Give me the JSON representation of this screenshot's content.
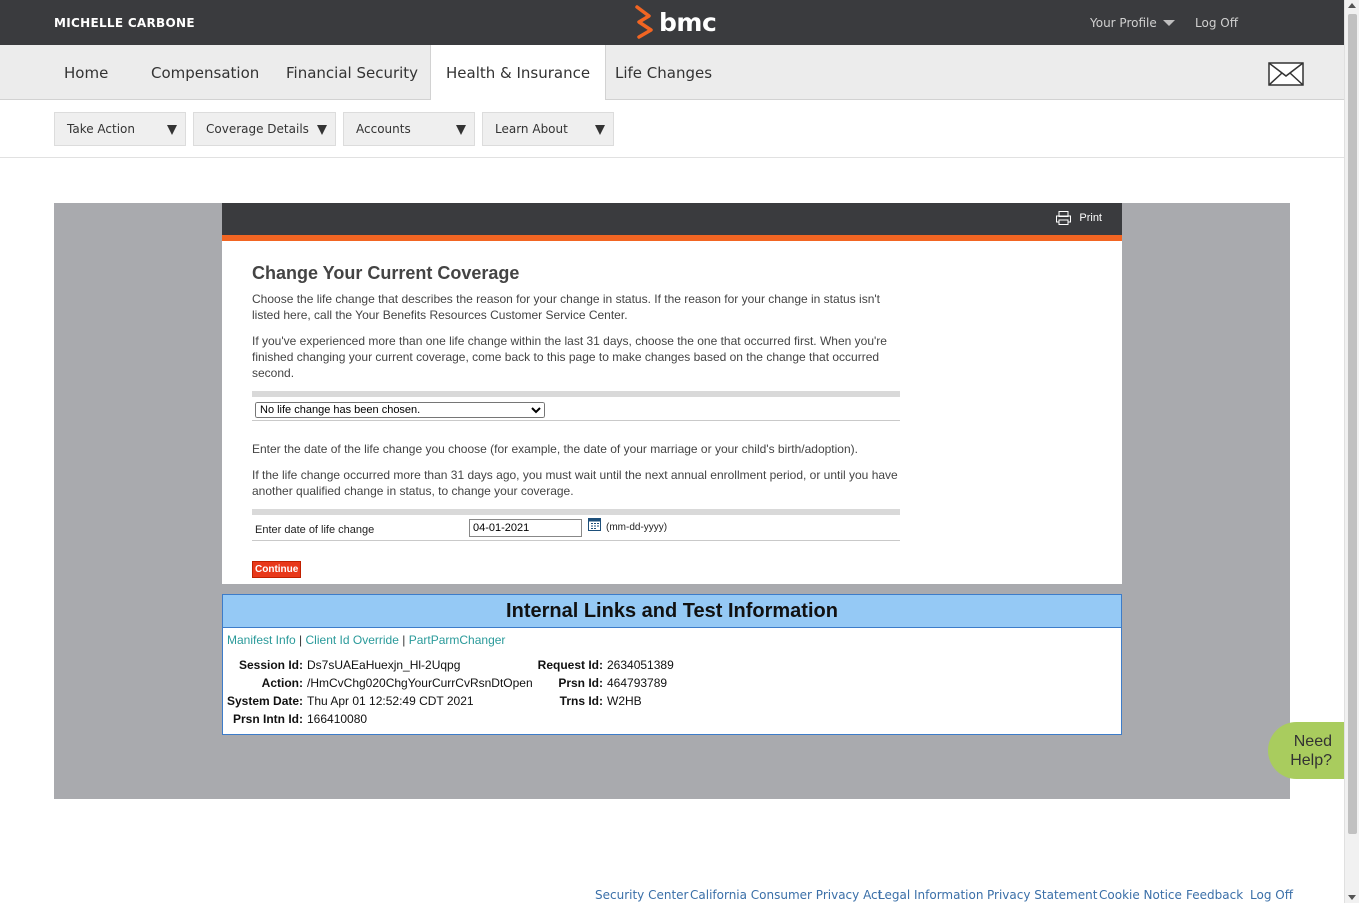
{
  "header": {
    "user_name": "MICHELLE CARBONE",
    "logo_text": "bmc",
    "profile_label": "Your Profile",
    "logoff_label": "Log Off"
  },
  "main_nav": {
    "tabs": [
      {
        "label": "Home"
      },
      {
        "label": "Compensation"
      },
      {
        "label": "Financial Security"
      },
      {
        "label": "Health & Insurance",
        "active": true
      },
      {
        "label": "Life Changes"
      }
    ]
  },
  "sub_nav": {
    "dropdowns": [
      {
        "label": "Take Action"
      },
      {
        "label": "Coverage Details"
      },
      {
        "label": "Accounts"
      },
      {
        "label": "Learn About"
      }
    ]
  },
  "panel": {
    "print_label": "Print",
    "title": "Change Your Current Coverage",
    "para1": "Choose the life change that describes the reason for your change in status. If the reason for your change in status isn't listed here, call the Your Benefits Resources Customer Service Center.",
    "para2": "If you've experienced more than one life change within the last 31 days, choose the one that occurred first. When you're finished changing your current coverage, come back to this page to make changes based on the change that occurred second.",
    "life_change_selected": "No life change has been chosen.",
    "para3": "Enter the date of the life change you choose (for example, the date of your marriage or your child's birth/adoption).",
    "para4": "If the life change occurred more than 31 days ago, you must wait until the next annual enrollment period, or until you have another qualified change in status, to change your coverage.",
    "date_label": "Enter date of life change",
    "date_value": "04-01-2021",
    "date_format": "(mm-dd-yyyy)",
    "continue_label": "Continue"
  },
  "test_info": {
    "title": "Internal Links and Test Information",
    "links": [
      "Manifest Info",
      "Client Id Override",
      "PartParmChanger"
    ],
    "separator": "|",
    "session_id_label": "Session Id:",
    "session_id": "Ds7sUAEaHuexjn_Hl-2Uqpg",
    "action_label": "Action:",
    "action": "/HmCvChg020ChgYourCurrCvRsnDtOpen",
    "system_date_label": "System Date:",
    "system_date": "Thu Apr 01 12:52:49 CDT 2021",
    "prsn_intn_id_label": "Prsn Intn Id:",
    "prsn_intn_id": "166410080",
    "request_id_label": "Request Id:",
    "request_id": "2634051389",
    "prsn_id_label": "Prsn Id:",
    "prsn_id": "464793789",
    "trns_id_label": "Trns Id:",
    "trns_id": "W2HB"
  },
  "need_help": {
    "line1": "Need",
    "line2": "Help?"
  },
  "footer": {
    "links": [
      "Security Center",
      "California Consumer Privacy Act",
      "Legal Information",
      "Privacy Statement",
      "Cookie Notice",
      "Feedback",
      "Log Off"
    ]
  },
  "colors": {
    "topbar": "#3a3b3e",
    "accent_orange": "#f26522",
    "continue_red": "#e8381a",
    "test_header_blue": "#95c9f5",
    "need_help_green": "#a9cc5e",
    "link_teal": "#2a9a9a",
    "footer_link": "#3a6fa8"
  }
}
